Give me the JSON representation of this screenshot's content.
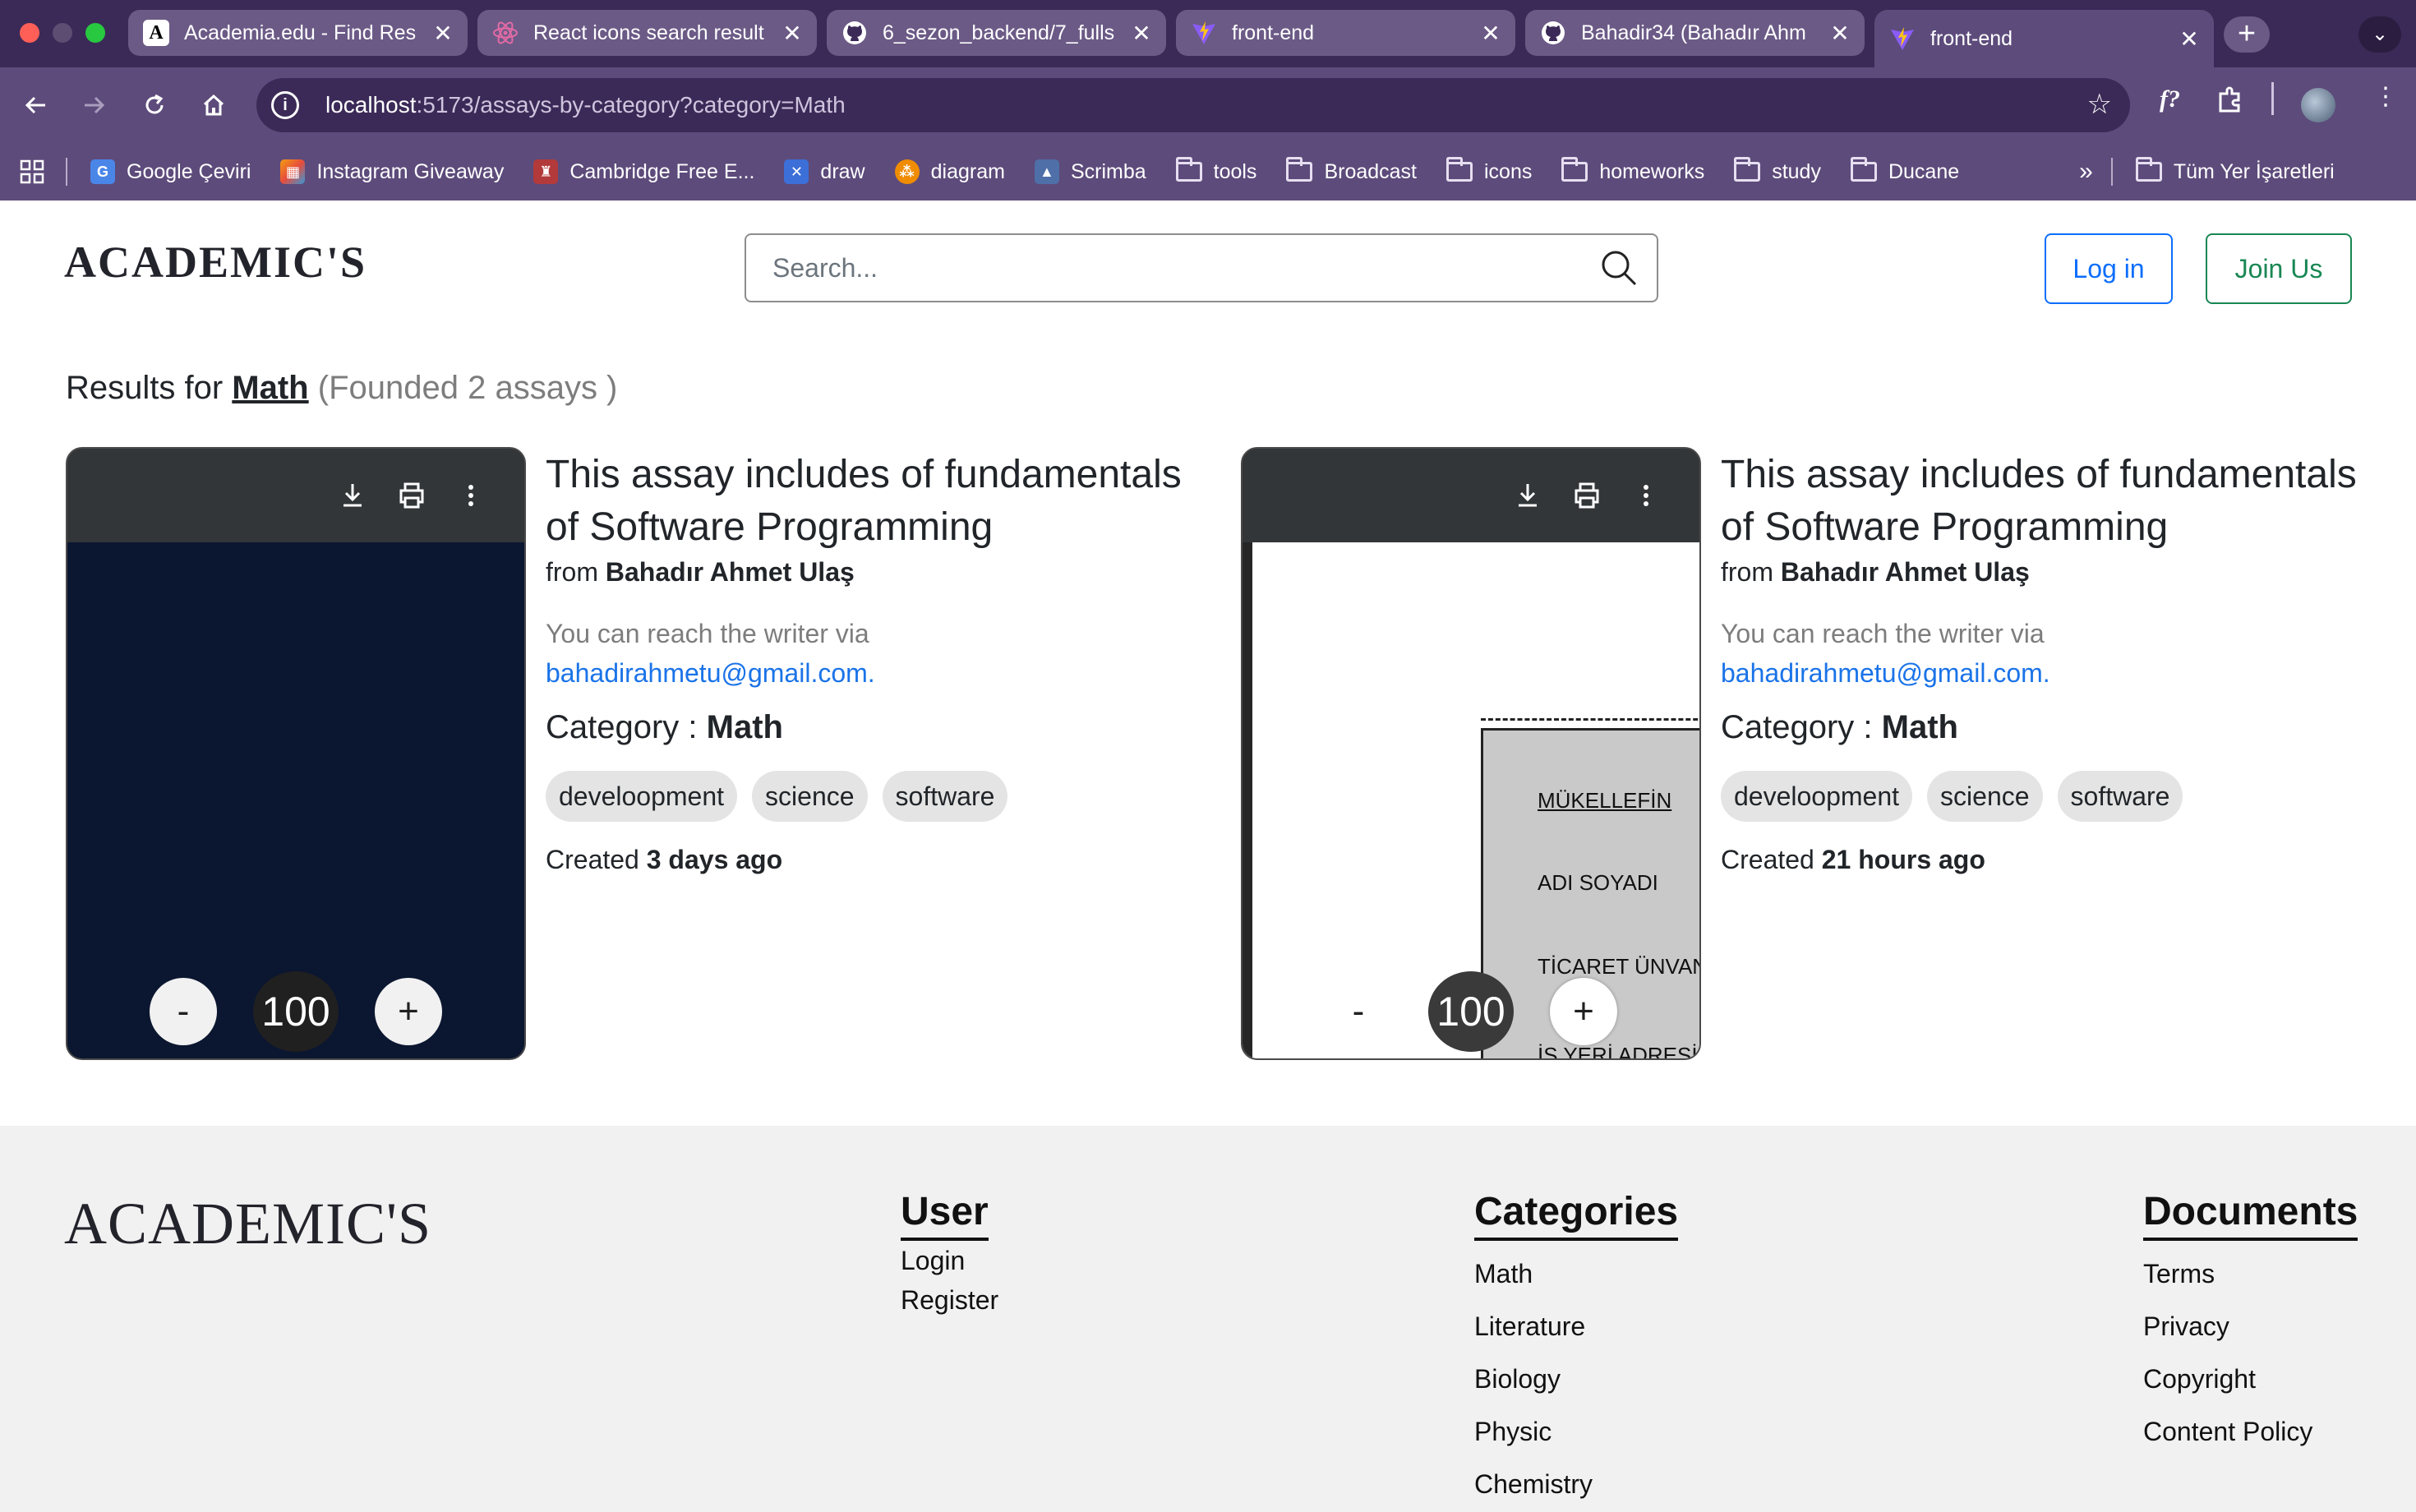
{
  "browser": {
    "tabs": [
      {
        "title": "Academia.edu - Find Res",
        "favicon": "academia-icon"
      },
      {
        "title": "React icons search result",
        "favicon": "react-icon"
      },
      {
        "title": "6_sezon_backend/7_fulls",
        "favicon": "github-icon"
      },
      {
        "title": "front-end",
        "favicon": "vite-icon"
      },
      {
        "title": "Bahadir34 (Bahadır Ahm",
        "favicon": "github-icon"
      },
      {
        "title": "front-end",
        "favicon": "vite-icon"
      }
    ],
    "url_host": "localhost",
    "url_rest": ":5173/assays-by-category?category=Math",
    "bookmarks": [
      {
        "label": "Google Çeviri",
        "icon": "translate-icon"
      },
      {
        "label": "Instagram Giveaway",
        "icon": "instagram-icon"
      },
      {
        "label": "Cambridge Free E...",
        "icon": "cambridge-icon"
      },
      {
        "label": "draw",
        "icon": "drawio-icon"
      },
      {
        "label": "diagram",
        "icon": "diagram-icon"
      },
      {
        "label": "Scrimba",
        "icon": "scrimba-icon"
      },
      {
        "label": "tools",
        "icon": "folder-icon"
      },
      {
        "label": "Broadcast",
        "icon": "folder-icon"
      },
      {
        "label": "icons",
        "icon": "folder-icon"
      },
      {
        "label": "homeworks",
        "icon": "folder-icon"
      },
      {
        "label": "study",
        "icon": "folder-icon"
      },
      {
        "label": "Ducane",
        "icon": "folder-icon"
      }
    ],
    "bookmarks_overflow": "»",
    "all_bookmarks": "Tüm Yer İşaretleri"
  },
  "header": {
    "logo": "ACADEMIC'S",
    "search_placeholder": "Search...",
    "login_label": "Log in",
    "join_label": "Join Us"
  },
  "results": {
    "prefix": "Results for ",
    "category": "Math",
    "count_text": "(Founded 2 assays )"
  },
  "cards": [
    {
      "title": "This assay includes of fundamentals of Software Programming",
      "from": "from ",
      "author": "Bahadır Ahmet Ulaş",
      "reach_text": "You can reach the writer via",
      "email": "bahadirahmetu@gmail.com.",
      "category_label": "Category : ",
      "category": "Math",
      "tags": [
        "develoopment",
        "science",
        "software"
      ],
      "created_label": "Created ",
      "created": "3 days ago",
      "zoom": {
        "minus": "-",
        "value": "100",
        "plus": "+"
      }
    },
    {
      "title": "This assay includes of fundamentals of Software Programming",
      "from": "from ",
      "author": "Bahadır Ahmet Ulaş",
      "reach_text": "You can reach the writer via",
      "email": "bahadirahmetu@gmail.com.",
      "category_label": "Category : ",
      "category": "Math",
      "tags": [
        "develoopment",
        "science",
        "software"
      ],
      "created_label": "Created ",
      "created": "21 hours ago",
      "zoom": {
        "minus": "-",
        "value": "100",
        "plus": "+"
      },
      "preview_labels": [
        "MÜKELLEFİN",
        "ADI SOYADI",
        "TİCARET ÜNVAN",
        "İŞ YERİ ADRESİ"
      ]
    }
  ],
  "footer": {
    "logo": "ACADEMIC'S",
    "user": {
      "heading": "User",
      "links": [
        "Login",
        "Register"
      ]
    },
    "categories": {
      "heading": "Categories",
      "links": [
        "Math",
        "Literature",
        "Biology",
        "Physic",
        "Chemistry"
      ]
    },
    "documents": {
      "heading": "Documents",
      "links": [
        "Terms",
        "Privacy",
        "Copyright",
        "Content Policy"
      ]
    }
  },
  "colors": {
    "chrome_dark": "#3b2a57",
    "chrome_mid": "#5d4b7b",
    "primary": "#0d6efd",
    "success": "#198754",
    "link": "#1a73e8"
  }
}
